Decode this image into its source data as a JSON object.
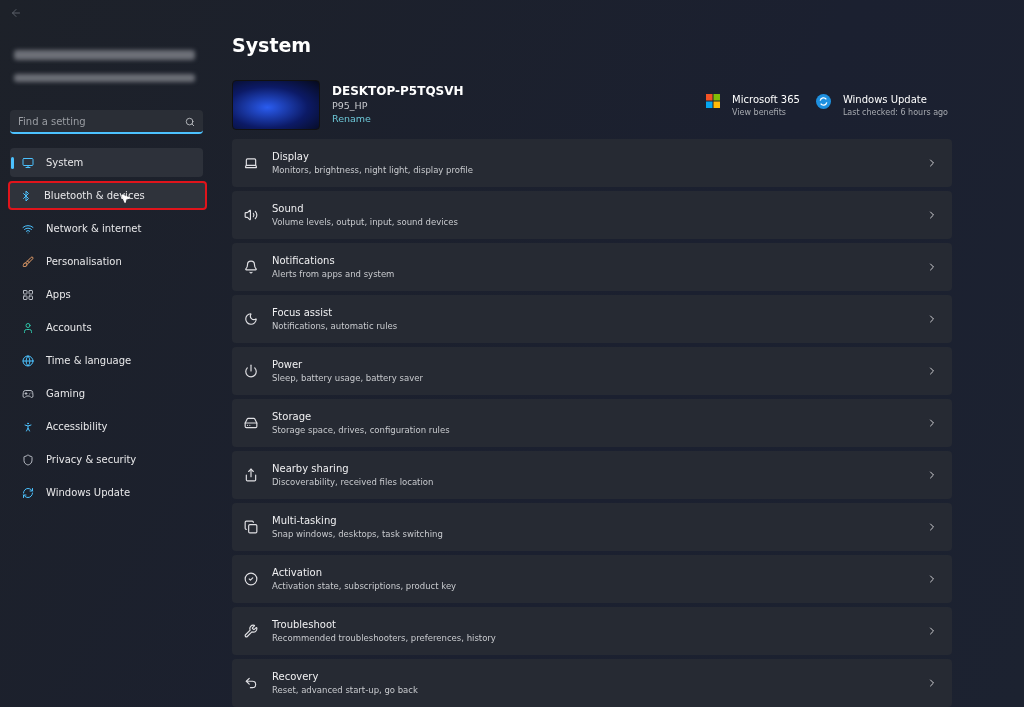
{
  "search": {
    "placeholder": "Find a setting"
  },
  "sidebar": {
    "items": [
      {
        "label": "System",
        "selected": true,
        "outlined": false
      },
      {
        "label": "Bluetooth & devices",
        "selected": false,
        "outlined": true
      },
      {
        "label": "Network & internet",
        "selected": false,
        "outlined": false
      },
      {
        "label": "Personalisation",
        "selected": false,
        "outlined": false
      },
      {
        "label": "Apps",
        "selected": false,
        "outlined": false
      },
      {
        "label": "Accounts",
        "selected": false,
        "outlined": false
      },
      {
        "label": "Time & language",
        "selected": false,
        "outlined": false
      },
      {
        "label": "Gaming",
        "selected": false,
        "outlined": false
      },
      {
        "label": "Accessibility",
        "selected": false,
        "outlined": false
      },
      {
        "label": "Privacy & security",
        "selected": false,
        "outlined": false
      },
      {
        "label": "Windows Update",
        "selected": false,
        "outlined": false
      }
    ]
  },
  "page_title": "System",
  "device": {
    "name": "DESKTOP-P5TQSVH",
    "model": "P95_HP",
    "rename": "Rename"
  },
  "quick_links": [
    {
      "title": "Microsoft 365",
      "subtitle": "View benefits"
    },
    {
      "title": "Windows Update",
      "subtitle": "Last checked: 6 hours ago"
    }
  ],
  "settings": [
    {
      "title": "Display",
      "subtitle": "Monitors, brightness, night light, display profile"
    },
    {
      "title": "Sound",
      "subtitle": "Volume levels, output, input, sound devices"
    },
    {
      "title": "Notifications",
      "subtitle": "Alerts from apps and system"
    },
    {
      "title": "Focus assist",
      "subtitle": "Notifications, automatic rules"
    },
    {
      "title": "Power",
      "subtitle": "Sleep, battery usage, battery saver"
    },
    {
      "title": "Storage",
      "subtitle": "Storage space, drives, configuration rules"
    },
    {
      "title": "Nearby sharing",
      "subtitle": "Discoverability, received files location"
    },
    {
      "title": "Multi-tasking",
      "subtitle": "Snap windows, desktops, task switching"
    },
    {
      "title": "Activation",
      "subtitle": "Activation state, subscriptions, product key"
    },
    {
      "title": "Troubleshoot",
      "subtitle": "Recommended troubleshooters, preferences, history"
    },
    {
      "title": "Recovery",
      "subtitle": "Reset, advanced start-up, go back"
    }
  ]
}
